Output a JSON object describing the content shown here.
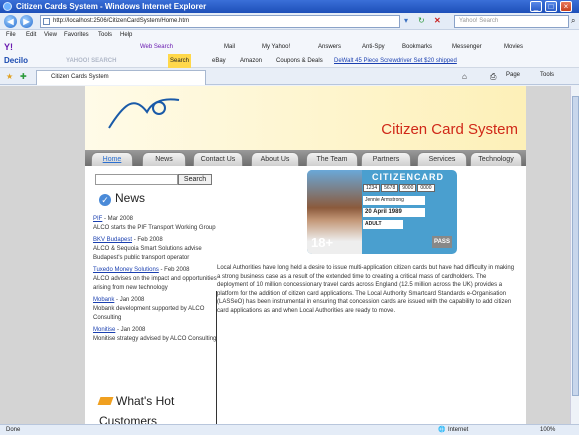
{
  "window": {
    "title": "Citizen Cards System - Windows Internet Explorer"
  },
  "address": {
    "url": "http://localhost:2506/CitizenCardSystem/Home.htm",
    "search_placeholder": "Yahoo! Search"
  },
  "menu": [
    "File",
    "Edit",
    "View",
    "Favorites",
    "Tools",
    "Help"
  ],
  "toolbar1": {
    "web_search": "Web Search",
    "mail": "Mail",
    "my_yahoo": "My Yahoo!",
    "answers": "Answers",
    "antispy": "Anti-Spy",
    "bookmarks": "Bookmarks",
    "messenger": "Messenger",
    "movies": "Movies"
  },
  "toolbar2": {
    "decilo": "Decilo",
    "yahoo_search": "YAHOO! SEARCH",
    "search": "Search",
    "ebay": "eBay",
    "amazon": "Amazon",
    "coupons": "Coupons & Deals",
    "promo": "DeWalt 45 Piece Screwdriver Set $20 shipped"
  },
  "tab": {
    "label": "Citizen Cards System",
    "home": "Page",
    "tools": "Tools"
  },
  "site": {
    "title": "Citizen Card System",
    "nav": [
      "Home",
      "News",
      "Contact Us",
      "About Us",
      "The Team",
      "Partners",
      "Services",
      "Technology"
    ],
    "search_button": "Search",
    "news_heading": "News",
    "news": [
      {
        "link": "PIF",
        "date": " - Mar 2008",
        "text": "ALCO starts the PIF Transport Working Group"
      },
      {
        "link": "BKV Budapest",
        "date": " - Feb 2008",
        "text": "ALCO & Sequoia Smart Solutions advise Budapest's public transport operator"
      },
      {
        "link": "Tuxedo Money Solutions",
        "date": " - Feb 2008",
        "text": "ALCO advises on the impact and opportunities arising from new technology"
      },
      {
        "link": "Mobank",
        "date": " - Jan 2008",
        "text": "Mobank development supported by ALCO Consulting"
      },
      {
        "link": "Monitise",
        "date": " - Jan 2008",
        "text": "Monitise strategy advised by ALCO Consulting"
      }
    ],
    "hot_heading": "What's Hot",
    "customers_heading": "Customers",
    "body": "Local Authorities have long held a desire to issue multi-application citizen cards but have had difficulty in making a strong business case as a result of the extended time to creating a critical mass of cardholders. The deployment of 10 million concessionary travel cards across England (12.5 million across the UK) provides a platform for the addition of citizen card applications. The Local Authority Smartcard Standards e-Organisation (LASSeO) has been instrumental in ensuring that concession cards are issued with the capability to add citizen card applications as and when Local Authorities are ready to move.",
    "card": {
      "brand": "CITIZENCARD",
      "nums": [
        "1234",
        "5678",
        "9000",
        "0000"
      ],
      "name": "Jennie Armstrong",
      "date": "20 April 1989",
      "adult": "ADULT",
      "age": "18+",
      "pass": "PASS"
    }
  },
  "status": {
    "left": "Done",
    "zone": "Internet",
    "zoom": "100%"
  }
}
